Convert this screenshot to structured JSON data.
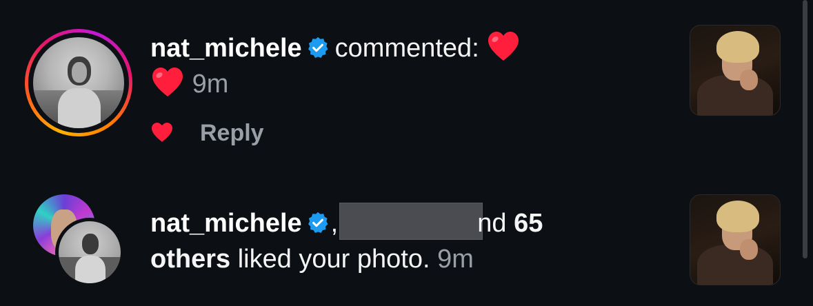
{
  "notifications": [
    {
      "type": "comment",
      "username": "nat_michele",
      "verified": true,
      "action_text": "commented:",
      "comment_emoji": "heart",
      "emoji_second_line": "heart",
      "timestamp": "9m",
      "reply_label": "Reply",
      "has_story_ring": true
    },
    {
      "type": "likes",
      "username": "nat_michele",
      "verified": true,
      "separator": ",",
      "partial_text": "nd",
      "count_text": "65",
      "others_label": "others",
      "action_text": "liked your photo.",
      "timestamp": "9m"
    }
  ],
  "colors": {
    "background": "#0c0f14",
    "verified_blue": "#1d9bf0",
    "heart_red": "#ff1f3d",
    "muted_text": "#9a9ea6"
  }
}
